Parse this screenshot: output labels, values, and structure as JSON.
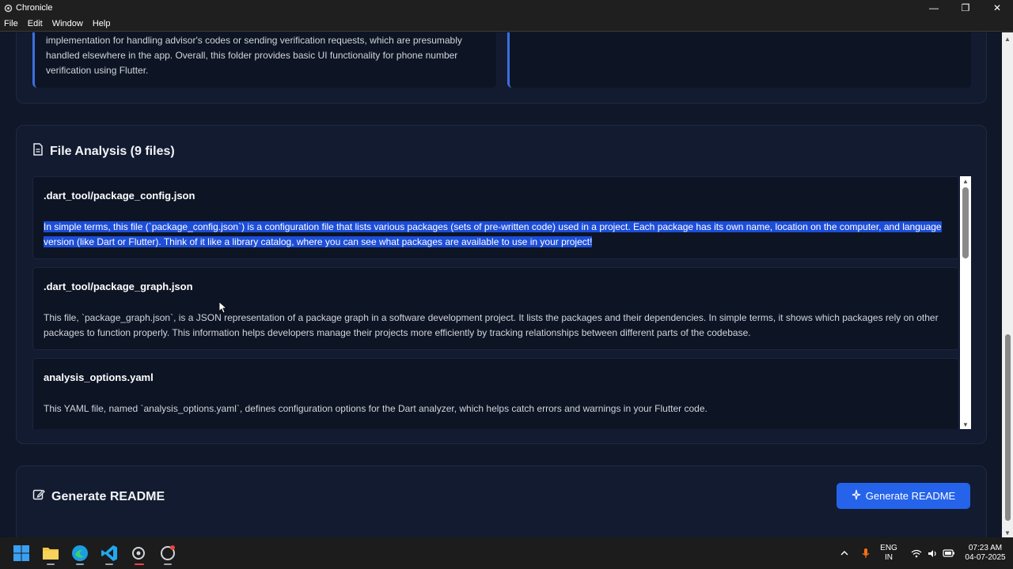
{
  "window": {
    "title": "Chronicle",
    "minimize": "—",
    "restore": "❐",
    "close": "✕"
  },
  "menu": [
    "File",
    "Edit",
    "Window",
    "Help"
  ],
  "folder_summary": {
    "left_text": "implementation for handling advisor's codes or sending verification requests, which are presumably handled elsewhere in the app. Overall, this folder provides basic UI functionality for phone number verification using Flutter."
  },
  "file_analysis": {
    "title": "File Analysis (9 files)",
    "files": [
      {
        "name": ".dart_tool/package_config.json",
        "description": "In simple terms, this file (`package_config.json`) is a configuration file that lists various packages (sets of pre-written code) used in a project. Each package has its own name, location on the computer, and language version (like Dart or Flutter). Think of it like a library catalog, where you can see what packages are available to use in your project!"
      },
      {
        "name": ".dart_tool/package_graph.json",
        "description": "This file, `package_graph.json`, is a JSON representation of a package graph in a software development project. It lists the packages and their dependencies. In simple terms, it shows which packages rely on other packages to function properly. This information helps developers manage their projects more efficiently by tracking relationships between different parts of the codebase."
      },
      {
        "name": "analysis_options.yaml",
        "description": "This YAML file, named `analysis_options.yaml`, defines configuration options for the Dart analyzer, which helps catch errors and warnings in your Flutter code."
      }
    ]
  },
  "readme": {
    "title": "Generate README",
    "button_label": "Generate README"
  },
  "taskbar": {
    "language": "ENG",
    "region": "IN",
    "time": "07:23 AM",
    "date": "04-07-2025"
  },
  "colors": {
    "accent": "#2563eb",
    "highlight": "#1d4ed8",
    "background": "#0f1729"
  }
}
